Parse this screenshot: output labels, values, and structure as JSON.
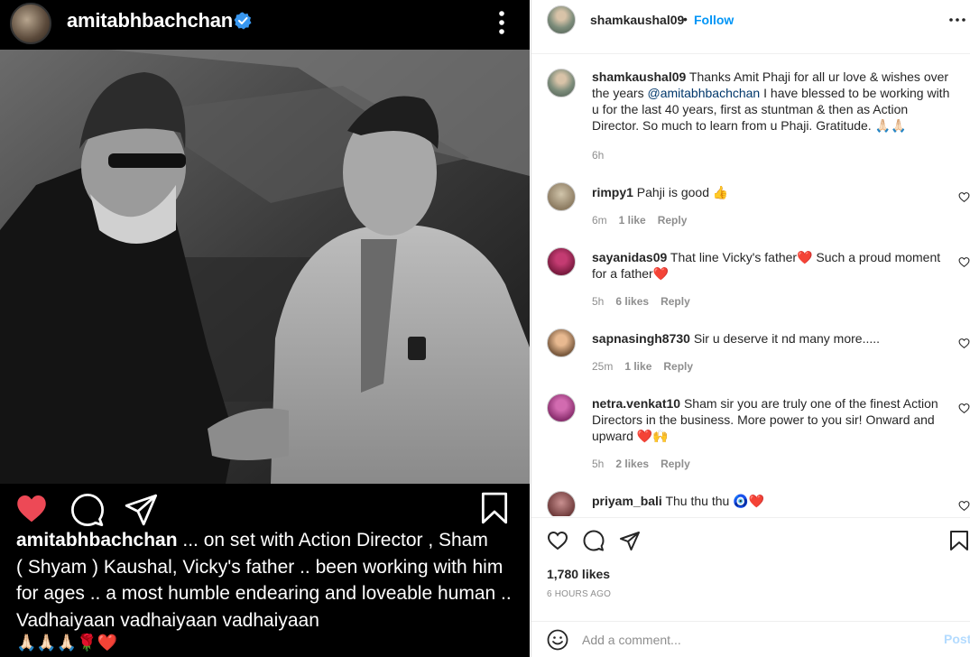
{
  "post": {
    "author": "amitabhbachchan",
    "caption_username": "amitabhbachchan",
    "caption_lines": [
      " ... on set with Action Director , Sham",
      "( Shyam ) Kaushal, Vicky's father .. been working with him",
      "for ages .. a most humble endearing and loveable human ..",
      "Vadhaiyaan vadhaiyaan vadhaiyaan"
    ],
    "caption_emojis": "🙏🏻🙏🏻🙏🏻🌹❤️"
  },
  "header": {
    "username": "shamkaushal09",
    "separator": "•",
    "follow_label": "Follow"
  },
  "owner_comment": {
    "username": "shamkaushal09",
    "text_before": " Thanks Amit Phaji for all ur love & wishes over the years ",
    "mention": "@amitabhbachchan",
    "text_after": " I have blessed to be working with u for the last 40 years, first as stuntman & then as Action Director. So much to learn from u Phaji. Gratitude. 🙏🏻🙏🏻",
    "time": "6h"
  },
  "comments": [
    {
      "username": "rimpy1",
      "text": " Pahji is good 👍",
      "time": "6m",
      "likes": "1 like",
      "reply": "Reply"
    },
    {
      "username": "sayanidas09",
      "text": " That line Vicky's father❤️ Such a proud moment for a father❤️",
      "time": "5h",
      "likes": "6 likes",
      "reply": "Reply"
    },
    {
      "username": "sapnasingh8730",
      "text": " Sir u deserve it nd many more.....",
      "time": "25m",
      "likes": "1 like",
      "reply": "Reply"
    },
    {
      "username": "netra.venkat10",
      "text": " Sham sir you are truly one of the finest Action Directors in the business. More power to you sir! Onward and upward ❤️🙌",
      "time": "5h",
      "likes": "2 likes",
      "reply": "Reply"
    },
    {
      "username": "priyam_bali",
      "text": " Thu thu thu 🧿❤️",
      "time": "",
      "likes": "",
      "reply": ""
    }
  ],
  "footer": {
    "likes": "1,780 likes",
    "timestamp": "6 HOURS AGO",
    "comment_placeholder": "Add a comment...",
    "post_label": "Post"
  },
  "colors": {
    "accent": "#0095f6",
    "like_red": "#ed4956",
    "post_disabled": "#b3dbff"
  }
}
